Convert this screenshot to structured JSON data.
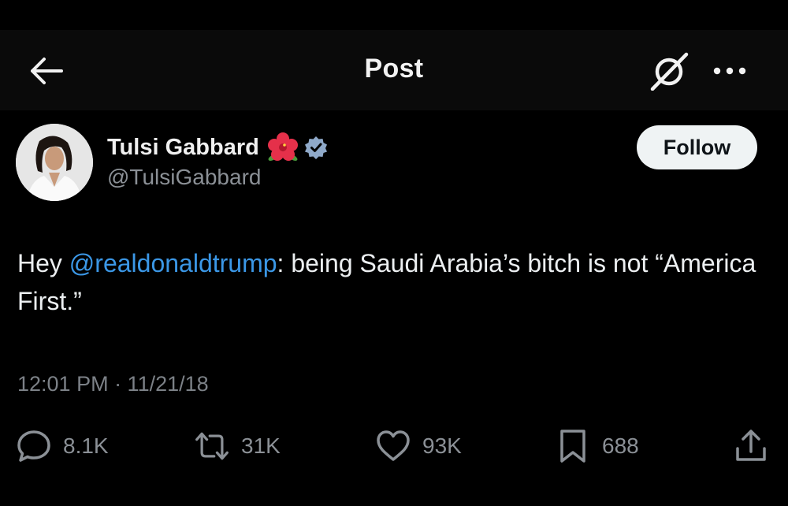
{
  "header": {
    "title": "Post"
  },
  "author": {
    "name": "Tulsi Gabbard",
    "handle": "@TulsiGabbard",
    "verified": true,
    "name_emoji": "hibiscus-icon"
  },
  "follow_button": {
    "label": "Follow"
  },
  "post": {
    "text_before": "Hey ",
    "mention": "@realdonaldtrump",
    "text_after": ": being Saudi Arabia’s bitch is not “America First.”",
    "timestamp": "12:01 PM · 11/21/18"
  },
  "actions": {
    "replies": "8.1K",
    "reposts": "31K",
    "likes": "93K",
    "bookmarks": "688"
  },
  "colors": {
    "background": "#000000",
    "header_background": "#0a0a0a",
    "text": "#e7e9ea",
    "secondary_text": "#8b9096",
    "mention": "#3b97e6",
    "verified_badge": "#8fa9c9",
    "follow_button_bg": "#eff3f4"
  }
}
